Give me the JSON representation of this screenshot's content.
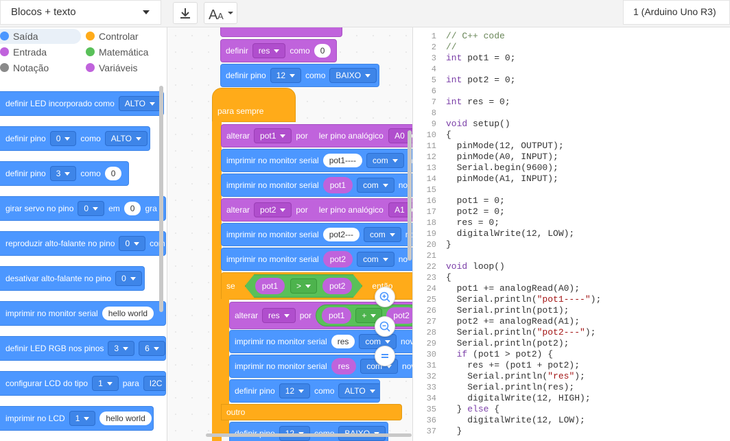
{
  "toolbar": {
    "mode_label": "Blocos + texto",
    "board_label": "1 (Arduino Uno R3)"
  },
  "categories": [
    {
      "label": "Saída",
      "color": "#4c97ff"
    },
    {
      "label": "Controlar",
      "color": "#ffab19"
    },
    {
      "label": "Entrada",
      "color": "#c063dc"
    },
    {
      "label": "Matemática",
      "color": "#59c059"
    },
    {
      "label": "Notação",
      "color": "#8a8a8a"
    },
    {
      "label": "Variáveis",
      "color": "#c063dc"
    }
  ],
  "palette_blocks": {
    "led": {
      "label": "definir LED incorporado como",
      "value": "ALTO"
    },
    "pin0": {
      "label": "definir pino",
      "pin": "0",
      "como": "como",
      "value": "ALTO"
    },
    "pin3": {
      "label": "definir pino",
      "pin": "3",
      "como": "como",
      "value": "0"
    },
    "servo": {
      "label": "girar servo no pino",
      "pin": "0",
      "em": "em",
      "value": "0",
      "suffix": "gra"
    },
    "speaker": {
      "label": "reproduzir alto-falante no pino",
      "pin": "0",
      "suffix": "com"
    },
    "speaker_off": {
      "label": "desativar alto-falante no pino",
      "pin": "0"
    },
    "serial": {
      "label": "imprimir no monitor serial",
      "value": "hello world"
    },
    "rgb": {
      "label": "definir LED RGB nos pinos",
      "a": "3",
      "b": "6"
    },
    "lcd_cfg": {
      "label": "configurar LCD do tipo",
      "a": "1",
      "para": "para",
      "b": "I2C"
    },
    "lcd_print": {
      "label": "imprimir no LCD",
      "a": "1",
      "value": "hello world"
    }
  },
  "workspace": {
    "def_res": {
      "label": "definir",
      "var": "res",
      "como": "como",
      "value": "0"
    },
    "def_pin": {
      "label": "definir pino",
      "pin": "12",
      "como": "como",
      "value": "BAIXO"
    },
    "forever": "para sempre",
    "alt1": {
      "label": "alterar",
      "var": "pot1",
      "por": "por",
      "read": "ler pino analógico",
      "pin": "A0"
    },
    "print1": {
      "label": "imprimir no monitor serial",
      "value": "pot1----",
      "com": "com",
      "suffix": "n"
    },
    "print2": {
      "label": "imprimir no monitor serial",
      "value": "pot1",
      "com": "com",
      "suffix": "nov"
    },
    "alt2": {
      "label": "alterar",
      "var": "pot2",
      "por": "por",
      "read": "ler pino analógico",
      "pin": "A1"
    },
    "print3": {
      "label": "imprimir no monitor serial",
      "value": "pot2---",
      "com": "com",
      "suffix": "no"
    },
    "print4": {
      "label": "imprimir no monitor serial",
      "value": "pot2",
      "com": "com",
      "suffix": "no"
    },
    "if": {
      "label": "se",
      "a": "pot1",
      "op": ">",
      "b": "pot2",
      "then": "então"
    },
    "alt3": {
      "label": "alterar",
      "var": "res",
      "por": "por",
      "a": "pot1",
      "op": "+",
      "b": "pot2"
    },
    "print5": {
      "label": "imprimir no monitor serial",
      "value": "res",
      "com": "com",
      "suffix": "nova"
    },
    "print6": {
      "label": "imprimir no monitor serial",
      "value": "res",
      "com": "com",
      "suffix": "nov"
    },
    "pin_high": {
      "label": "definir pino",
      "pin": "12",
      "como": "como",
      "value": "ALTO"
    },
    "else": "outro",
    "pin_low": {
      "label": "definir pino",
      "pin": "12",
      "como": "como",
      "value": "BAIXO"
    }
  },
  "code_lines": [
    "// C++ code",
    "//",
    "int pot1 = 0;",
    "",
    "int pot2 = 0;",
    "",
    "int res = 0;",
    "",
    "void setup()",
    "{",
    "  pinMode(12, OUTPUT);",
    "  pinMode(A0, INPUT);",
    "  Serial.begin(9600);",
    "  pinMode(A1, INPUT);",
    "",
    "  pot1 = 0;",
    "  pot2 = 0;",
    "  res = 0;",
    "  digitalWrite(12, LOW);",
    "}",
    "",
    "void loop()",
    "{",
    "  pot1 += analogRead(A0);",
    "  Serial.println(\"pot1----\");",
    "  Serial.println(pot1);",
    "  pot2 += analogRead(A1);",
    "  Serial.println(\"pot2---\");",
    "  Serial.println(pot2);",
    "  if (pot1 > pot2) {",
    "    res += (pot1 + pot2);",
    "    Serial.println(\"res\");",
    "    Serial.println(res);",
    "    digitalWrite(12, HIGH);",
    "  } else {",
    "    digitalWrite(12, LOW);",
    "  }"
  ]
}
